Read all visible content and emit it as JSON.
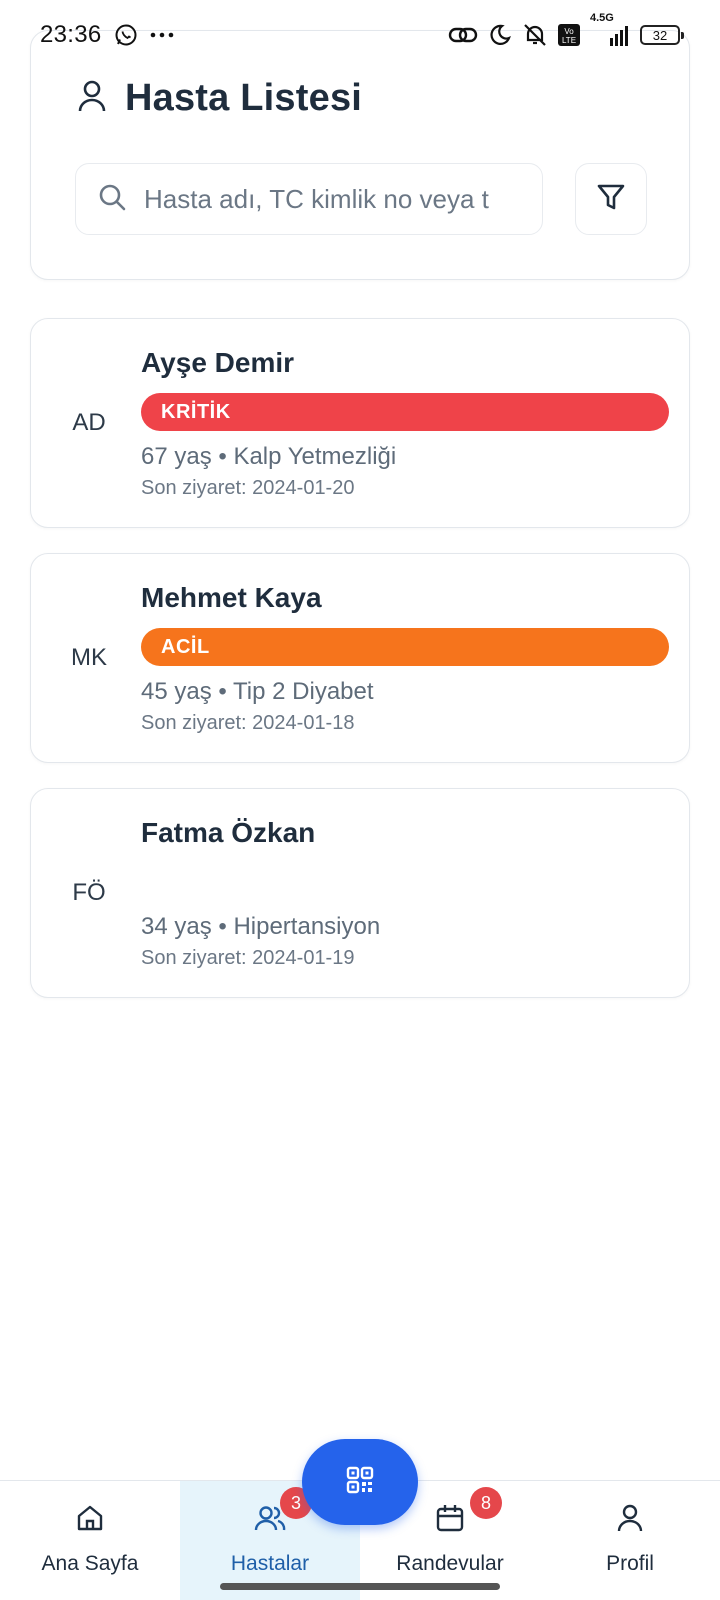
{
  "status_bar": {
    "time": "23:36",
    "battery": "32",
    "network": "4.5G"
  },
  "header": {
    "title": "Hasta Listesi",
    "title_icon": "user-icon"
  },
  "search": {
    "placeholder": "Hasta adı, TC kimlik no veya t",
    "icon": "search-icon"
  },
  "filter": {
    "icon": "filter-icon"
  },
  "patients": [
    {
      "initials": "AD",
      "name": "Ayşe Demir",
      "status": "KRİTİK",
      "status_color": "#ef4349",
      "meta": "67 yaş • Kalp Yetmezliği",
      "last_visit": "Son ziyaret: 2024-01-20"
    },
    {
      "initials": "MK",
      "name": "Mehmet Kaya",
      "status": "ACİL",
      "status_color": "#f6741c",
      "meta": "45 yaş • Tip 2 Diyabet",
      "last_visit": "Son ziyaret: 2024-01-18"
    },
    {
      "initials": "FÖ",
      "name": "Fatma Özkan",
      "status": "",
      "status_color": "",
      "meta": "34 yaş • Hipertansiyon",
      "last_visit": "Son ziyaret: 2024-01-19"
    }
  ],
  "bottom_nav": {
    "items": [
      {
        "label": "Ana Sayfa",
        "icon": "home-icon",
        "active": false,
        "badge": ""
      },
      {
        "label": "Hastalar",
        "icon": "users-icon",
        "active": true,
        "badge": "3"
      },
      {
        "label": "Randevular",
        "icon": "calendar-icon",
        "active": false,
        "badge": "8"
      },
      {
        "label": "Profil",
        "icon": "profile-icon",
        "active": false,
        "badge": ""
      }
    ]
  },
  "fab": {
    "icon": "qr-code-icon"
  },
  "colors": {
    "accent": "#2563eb",
    "critical": "#ef4349",
    "urgent": "#f6741c",
    "badge": "#e5474b",
    "active_nav_bg": "#e6f4fb"
  }
}
